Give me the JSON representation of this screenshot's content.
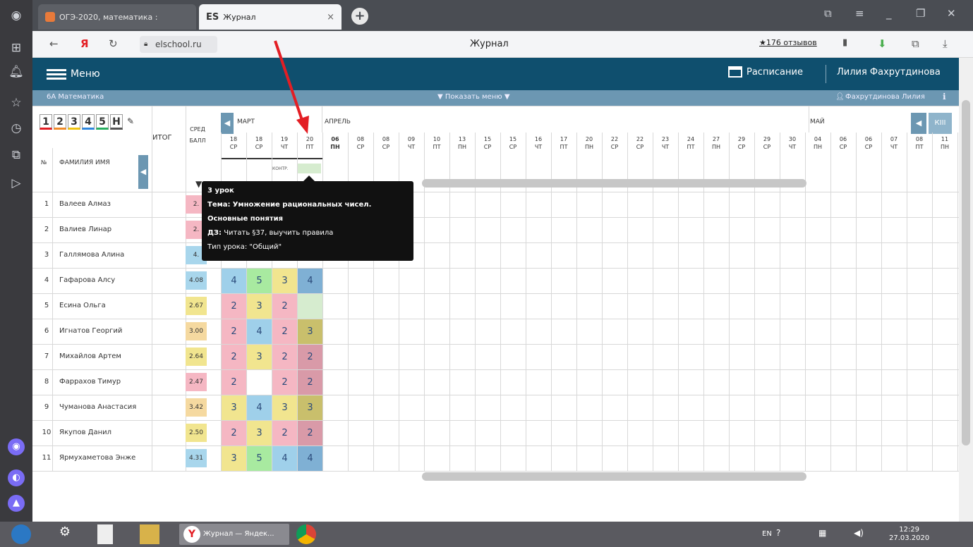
{
  "browser": {
    "tabs": [
      {
        "label": "ОГЭ-2020, математика :"
      },
      {
        "label": "Журнал",
        "favicon_text": "ES"
      }
    ],
    "url": "elschool.ru",
    "page_title": "Журнал",
    "reviews": "★176 отзывов"
  },
  "header": {
    "menu_label": "Меню",
    "schedule_label": "Расписание",
    "user_name": "Лилия Фахрутдинова"
  },
  "subbar": {
    "class_subject": "6А Математика",
    "show_menu": "▼ Показать меню ▼",
    "teacher": "Фахрутдинова Лилия"
  },
  "journal": {
    "mark_filters": [
      "1",
      "2",
      "3",
      "4",
      "5",
      "Н"
    ],
    "col_no": "№",
    "col_name": "ФАМИЛИЯ ИМЯ",
    "col_final": "ИТОГ",
    "col_avg": "СРЕД БАЛЛ",
    "months": [
      "МАРТ",
      "АПРЕЛЬ",
      "МАЙ"
    ],
    "quarter_label": "КIII",
    "work_type_label": "КОНТР.",
    "dates": [
      {
        "d": "18",
        "w": "СР"
      },
      {
        "d": "18",
        "w": "СР"
      },
      {
        "d": "19",
        "w": "ЧТ"
      },
      {
        "d": "20",
        "w": "ПТ"
      },
      {
        "d": "06",
        "w": "ПН"
      },
      {
        "d": "08",
        "w": "СР"
      },
      {
        "d": "08",
        "w": "СР"
      },
      {
        "d": "09",
        "w": "ЧТ"
      },
      {
        "d": "10",
        "w": "ПТ"
      },
      {
        "d": "13",
        "w": "ПН"
      },
      {
        "d": "15",
        "w": "СР"
      },
      {
        "d": "15",
        "w": "СР"
      },
      {
        "d": "16",
        "w": "ЧТ"
      },
      {
        "d": "17",
        "w": "ПТ"
      },
      {
        "d": "20",
        "w": "ПН"
      },
      {
        "d": "22",
        "w": "СР"
      },
      {
        "d": "22",
        "w": "СР"
      },
      {
        "d": "23",
        "w": "ЧТ"
      },
      {
        "d": "24",
        "w": "ПТ"
      },
      {
        "d": "27",
        "w": "ПН"
      },
      {
        "d": "29",
        "w": "СР"
      },
      {
        "d": "29",
        "w": "СР"
      },
      {
        "d": "30",
        "w": "ЧТ"
      },
      {
        "d": "04",
        "w": "ПН"
      },
      {
        "d": "06",
        "w": "СР"
      },
      {
        "d": "06",
        "w": "СР"
      },
      {
        "d": "07",
        "w": "ЧТ"
      },
      {
        "d": "08",
        "w": "ПТ"
      },
      {
        "d": "11",
        "w": "ПН"
      }
    ],
    "students": [
      {
        "no": "1",
        "name": "Валеев Алмаз",
        "avg": "2.",
        "marks": [
          "",
          "",
          "",
          ""
        ]
      },
      {
        "no": "2",
        "name": "Валиев Линар",
        "avg": "2.",
        "marks": [
          "",
          "",
          "",
          ""
        ]
      },
      {
        "no": "3",
        "name": "Галлямова Алина",
        "avg": "4.",
        "marks": [
          "",
          "",
          "",
          ""
        ]
      },
      {
        "no": "4",
        "name": "Гафарова Алсу",
        "avg": "4.08",
        "marks": [
          "4",
          "5",
          "3",
          "4"
        ]
      },
      {
        "no": "5",
        "name": "Есина Ольга",
        "avg": "2.67",
        "marks": [
          "2",
          "3",
          "2",
          ""
        ]
      },
      {
        "no": "6",
        "name": "Игнатов Георгий",
        "avg": "3.00",
        "marks": [
          "2",
          "4",
          "2",
          "3"
        ]
      },
      {
        "no": "7",
        "name": "Михайлов Артем",
        "avg": "2.64",
        "marks": [
          "2",
          "3",
          "2",
          "2"
        ]
      },
      {
        "no": "8",
        "name": "Фаррахов Тимур",
        "avg": "2.47",
        "marks": [
          "2",
          "",
          "2",
          "2"
        ]
      },
      {
        "no": "9",
        "name": "Чуманова Анастасия",
        "avg": "3.42",
        "marks": [
          "3",
          "4",
          "3",
          "3"
        ]
      },
      {
        "no": "10",
        "name": "Якупов Данил",
        "avg": "2.50",
        "marks": [
          "2",
          "3",
          "2",
          "2"
        ]
      },
      {
        "no": "11",
        "name": "Ярмухаметова Энже",
        "avg": "4.31",
        "marks": [
          "3",
          "5",
          "4",
          "4"
        ]
      }
    ]
  },
  "tooltip": {
    "lesson": "3 урок",
    "topic_label": "Тема:",
    "topic": "Умножение рациональных чисел. Основные понятия",
    "hw_label": "ДЗ:",
    "hw": "Читать §37, выучить правила",
    "type": "Тип урока: \"Общий\""
  },
  "taskbar": {
    "app_label": "Журнал — Яндек...",
    "lang": "EN",
    "time": "12:29",
    "date": "27.03.2020"
  },
  "colors": {
    "mark2": "#f5b7c3",
    "mark3": "#f1e58f",
    "mark4": "#9fd0ea",
    "mark5": "#a8eaa0",
    "avg_low": "#f5d9a0",
    "avg_mid": "#f1e58f",
    "avg_high": "#a8d6ec",
    "avg_red": "#f5b7c3",
    "header_bg": "#0f4f6e",
    "arrow": "#e31e24"
  }
}
